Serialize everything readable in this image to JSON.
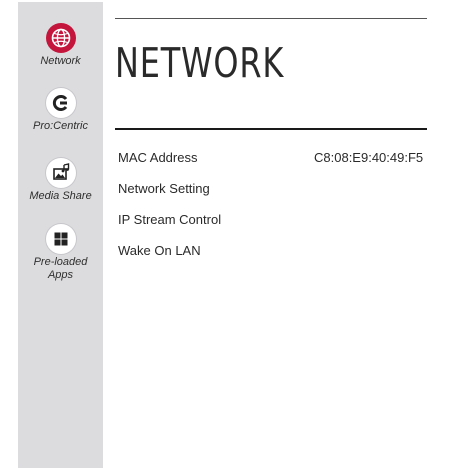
{
  "sidebar": {
    "items": [
      {
        "label": "Network",
        "icon": "globe-icon",
        "active": true
      },
      {
        "label": "Pro:Centric",
        "icon": "procentric-icon",
        "active": false
      },
      {
        "label": "Media Share",
        "icon": "media-share-icon",
        "active": false
      },
      {
        "label": "Pre-loaded Apps",
        "icon": "apps-grid-icon",
        "active": false
      }
    ]
  },
  "main": {
    "title": "NETWORK",
    "rows": [
      {
        "label": "MAC Address",
        "value": "C8:08:E9:40:49:F5"
      },
      {
        "label": "Network Setting"
      },
      {
        "label": "IP Stream Control"
      },
      {
        "label": "Wake On LAN"
      }
    ]
  },
  "colors": {
    "accent": "#c4163c",
    "sidebar_bg": "#dcdcde",
    "text": "#2a2a2a"
  }
}
